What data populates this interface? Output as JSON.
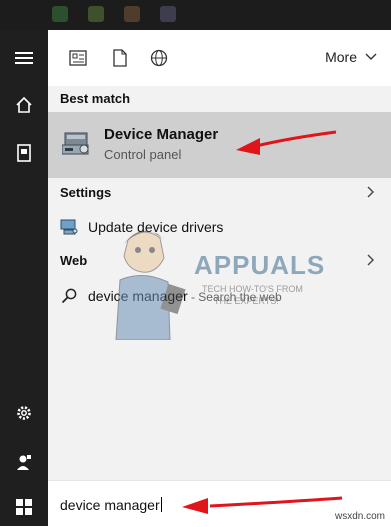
{
  "toolbar": {
    "more_label": "More"
  },
  "sections": {
    "best_match": "Best match",
    "settings": "Settings",
    "web": "Web"
  },
  "best_match_item": {
    "title": "Device Manager",
    "subtitle": "Control panel"
  },
  "settings_item": {
    "label": "Update device drivers"
  },
  "web_item": {
    "query": "device manager",
    "suffix": " - Search the web"
  },
  "search": {
    "value": "device manager"
  },
  "watermark": {
    "brand": "APPUALS",
    "tagline_1": "TECH HOW-TO'S FROM",
    "tagline_2": "THE EXPERTS!"
  },
  "credit": "wsxdn.com",
  "colors": {
    "selected_row": "#cfcfcf",
    "panel_bg": "#f2f2f2",
    "sidebar_bg": "#1f1f1f",
    "arrow": "#e0151b"
  },
  "icons": [
    "hamburger-icon",
    "home-icon",
    "notebook-icon",
    "gear-icon",
    "user-icon",
    "windows-icon",
    "apps-filter-icon",
    "documents-filter-icon",
    "web-filter-icon",
    "device-manager-icon",
    "settings-device-icon",
    "search-icon",
    "chevron-down-icon",
    "chevron-right-icon"
  ]
}
